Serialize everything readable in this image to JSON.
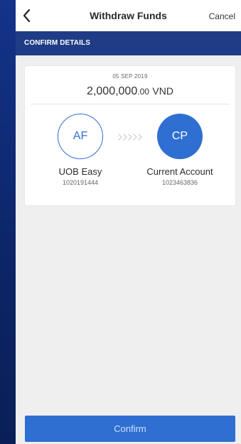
{
  "header": {
    "title": "Withdraw Funds",
    "cancel_label": "Cancel"
  },
  "section": {
    "label": "CONFIRM DETAILS"
  },
  "details": {
    "date": "05 SEP 2019",
    "amount_main": "2,000,000",
    "amount_decimal": ".00",
    "currency": "VND",
    "from": {
      "initials": "AF",
      "name": "UOB Easy",
      "number": "1020191444"
    },
    "to": {
      "initials": "CP",
      "name": "Current Account",
      "number": "1023463836"
    }
  },
  "footer": {
    "confirm_label": "Confirm"
  },
  "colors": {
    "brand_navy": "#203c86",
    "accent_blue": "#2f6fd1",
    "background": "#efefef"
  },
  "icons": {
    "back": "chevron-left-icon",
    "transfer": "chevron-right-arrows-icon"
  }
}
